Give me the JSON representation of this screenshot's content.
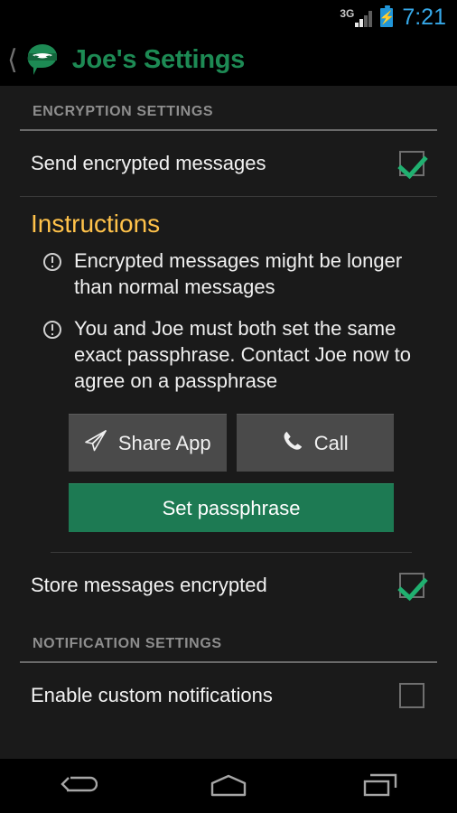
{
  "status_bar": {
    "network_label": "3G",
    "network_icon": "signal-bars-icon",
    "battery_icon": "battery-charging-icon",
    "time": "7:21",
    "time_color": "#36a8e8"
  },
  "action_bar": {
    "back_icon": "back-chevron-icon",
    "app_logo": "ninja-chat-logo-icon",
    "title": "Joe's Settings",
    "title_color": "#1d8a54"
  },
  "sections": {
    "encryption": {
      "header": "ENCRYPTION SETTINGS",
      "send_encrypted": {
        "label": "Send encrypted messages",
        "checked": true
      },
      "store_encrypted": {
        "label": "Store messages encrypted",
        "checked": true
      }
    },
    "notification": {
      "header": "NOTIFICATION SETTINGS",
      "enable_custom": {
        "label": "Enable custom notifications",
        "checked": false
      }
    }
  },
  "instructions": {
    "title": "Instructions",
    "title_color": "#ffc24a",
    "bullets": [
      "Encrypted messages might be longer than normal messages",
      "You and Joe must both set the same exact passphrase. Contact Joe now to agree on a passphrase"
    ],
    "share_button": {
      "label": "Share App",
      "icon": "paper-plane-icon"
    },
    "call_button": {
      "label": "Call",
      "icon": "phone-handset-icon"
    },
    "passphrase_button": {
      "label": "Set passphrase",
      "color": "#1d7a53"
    }
  },
  "nav_bar": {
    "back": "back-arrow-icon",
    "home": "home-icon",
    "recents": "recent-apps-icon"
  }
}
